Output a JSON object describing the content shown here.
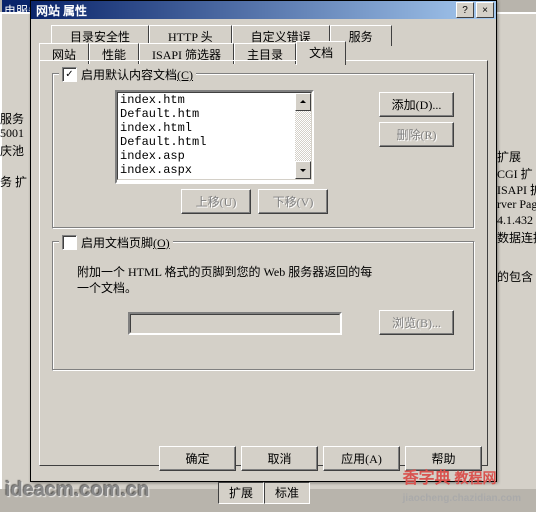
{
  "dialog": {
    "title": "网站 属性",
    "help_btn": "?",
    "close_btn": "×",
    "tabs_row1": [
      "目录安全性",
      "HTTP 头",
      "自定义错误",
      "服务"
    ],
    "tabs_row2": [
      "网站",
      "性能",
      "ISAPI 筛选器",
      "主目录",
      "文档"
    ],
    "active_tab": "文档"
  },
  "default_docs": {
    "checkbox_label": "启用默认内容文档",
    "checkbox_key": "(C)",
    "checked": true,
    "items": [
      "index.htm",
      "Default.htm",
      "index.html",
      "Default.html",
      "index.asp",
      "index.aspx"
    ],
    "add_btn": "添加(D)...",
    "remove_btn": "删除(R)",
    "up_btn": "上移(U)",
    "down_btn": "下移(V)"
  },
  "footer_group": {
    "checkbox_label": "启用文档页脚",
    "checkbox_key": "(O)",
    "checked": false,
    "description": "附加一个 HTML 格式的页脚到您的 Web 服务器返回的每一个文档。",
    "input_value": "",
    "browse_btn": "浏览(B)..."
  },
  "buttons": {
    "ok": "确定",
    "cancel": "取消",
    "apply": "应用(A)",
    "help": "帮助"
  },
  "background": {
    "header_left": "电服务",
    "col_header": "扩展",
    "rows": [
      "CGI 扩",
      "ISAPI 扩",
      "rver Pag",
      "4.1.432",
      "数据连接"
    ],
    "footer_row": "的包含",
    "sidebar": [
      "服务",
      "5001",
      "庆池",
      "务 扩"
    ],
    "bottom_tabs": [
      "扩展",
      "标准"
    ]
  },
  "watermark": {
    "left": "ideacm.com.cn",
    "right_bold": "香字典",
    "right_text": " 教程网",
    "right_sub": "jiaocheng.chazidian.com"
  }
}
